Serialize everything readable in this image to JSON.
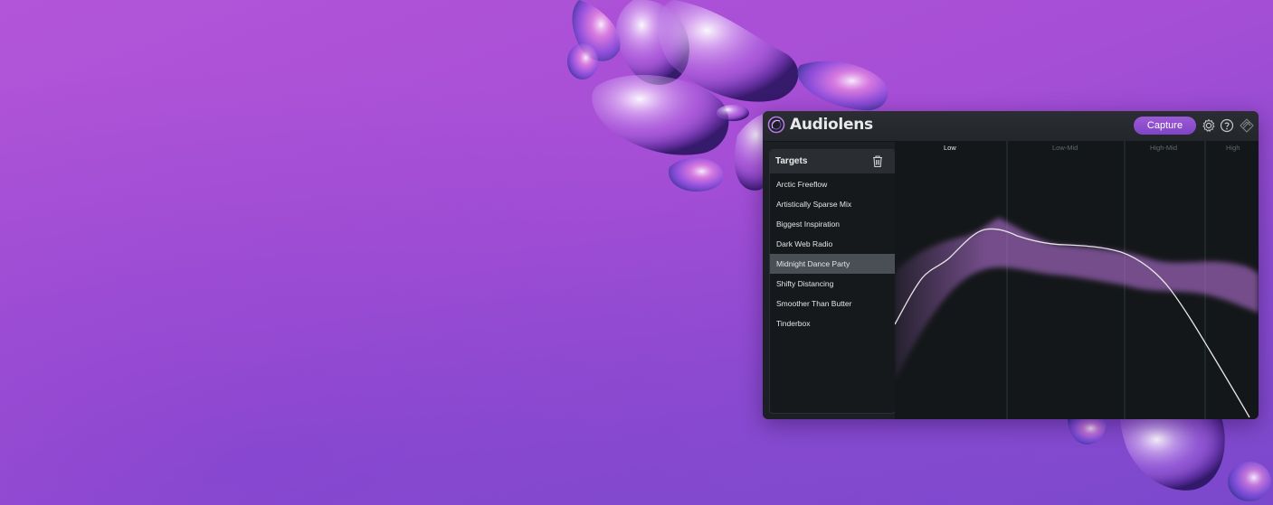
{
  "app": {
    "title": "Audiolens",
    "capture_label": "Capture"
  },
  "targets": {
    "title": "Targets",
    "items": [
      "Arctic Freeflow",
      "Artistically Sparse Mix",
      "Biggest Inspiration",
      "Dark Web Radio",
      "Midnight Dance Party",
      "Shifty Distancing",
      "Smoother Than Butter",
      "Tinderbox"
    ],
    "selected_index": 4
  },
  "bands": {
    "low": "Low",
    "low_mid": "Low-Mid",
    "high_mid": "High-Mid",
    "high": "High"
  },
  "icons": {
    "logo": "audiolens-logo-icon",
    "settings": "gear-icon",
    "help": "question-icon",
    "link": "izotope-link-icon",
    "delete": "trash-icon"
  },
  "colors": {
    "accent": "#9d5ad8",
    "target_band": "#c27ae6",
    "spectrum_line": "#e6e6e6",
    "panel": "#1c1f23"
  }
}
